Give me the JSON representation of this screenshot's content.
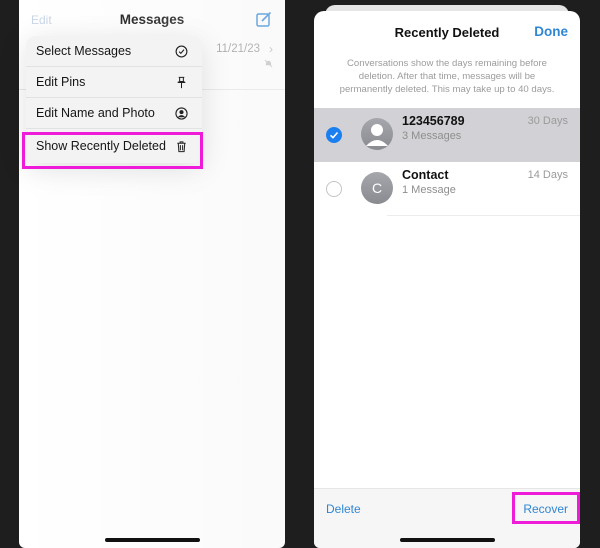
{
  "left": {
    "nav": {
      "edit_label": "Edit",
      "title": "Messages"
    },
    "conversation": {
      "date": "11/21/23"
    },
    "menu": {
      "items": [
        {
          "label": "Select Messages",
          "icon": "checkmark-circle-icon"
        },
        {
          "label": "Edit Pins",
          "icon": "pin-icon"
        },
        {
          "label": "Edit Name and Photo",
          "icon": "person-circle-icon"
        },
        {
          "label": "Show Recently Deleted",
          "icon": "trash-icon",
          "highlighted": true
        }
      ]
    }
  },
  "right": {
    "title": "Recently Deleted",
    "done_label": "Done",
    "note": "Conversations show the days remaining before deletion. After that time, messages will be permanently deleted. This may take up to 40 days.",
    "conversations": [
      {
        "name": "123456789",
        "subtitle": "3 Messages",
        "days": "30 Days",
        "selected": true,
        "avatar": "person-icon"
      },
      {
        "name": "Contact",
        "subtitle": "1 Message",
        "days": "14 Days",
        "selected": false,
        "avatar_initial": "C"
      }
    ],
    "toolbar": {
      "delete_label": "Delete",
      "recover_label": "Recover"
    }
  },
  "colors": {
    "accent": "#2f86d3",
    "highlight": "#ee1bd8",
    "selected_row": "#d2d2d6",
    "checkbox": "#1c7ff0"
  }
}
